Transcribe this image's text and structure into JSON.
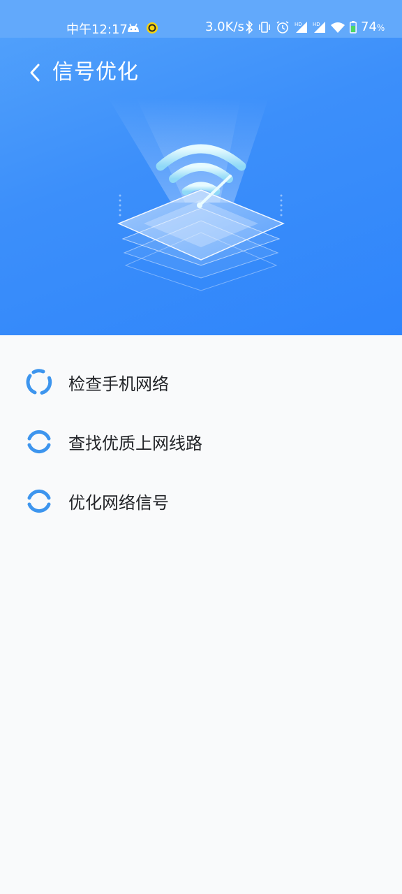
{
  "status_bar": {
    "time": "中午12:17",
    "net_speed": "3.0K/s",
    "battery_percent": "74",
    "battery_unit": "%",
    "icons": [
      "android-icon",
      "notification-ring-icon",
      "bluetooth-icon",
      "vibrate-icon",
      "alarm-icon",
      "hd-signal-icon",
      "hd-signal-icon",
      "wifi-icon",
      "battery-icon"
    ]
  },
  "header": {
    "title": "信号优化",
    "back_icon": "chevron-left-icon"
  },
  "hero": {
    "illustration": "wifi-signal-platform-illustration"
  },
  "steps": [
    {
      "label": "检查手机网络",
      "icon": "loading-spinner-icon"
    },
    {
      "label": "查找优质上网线路",
      "icon": "loading-spinner-icon"
    },
    {
      "label": "优化网络信号",
      "icon": "loading-spinner-icon"
    }
  ],
  "colors": {
    "hero_top": "#54a3fb",
    "hero_bottom": "#2f85fb",
    "spinner": "#3d95ee",
    "background": "#f9fafb",
    "text": "#222428"
  }
}
